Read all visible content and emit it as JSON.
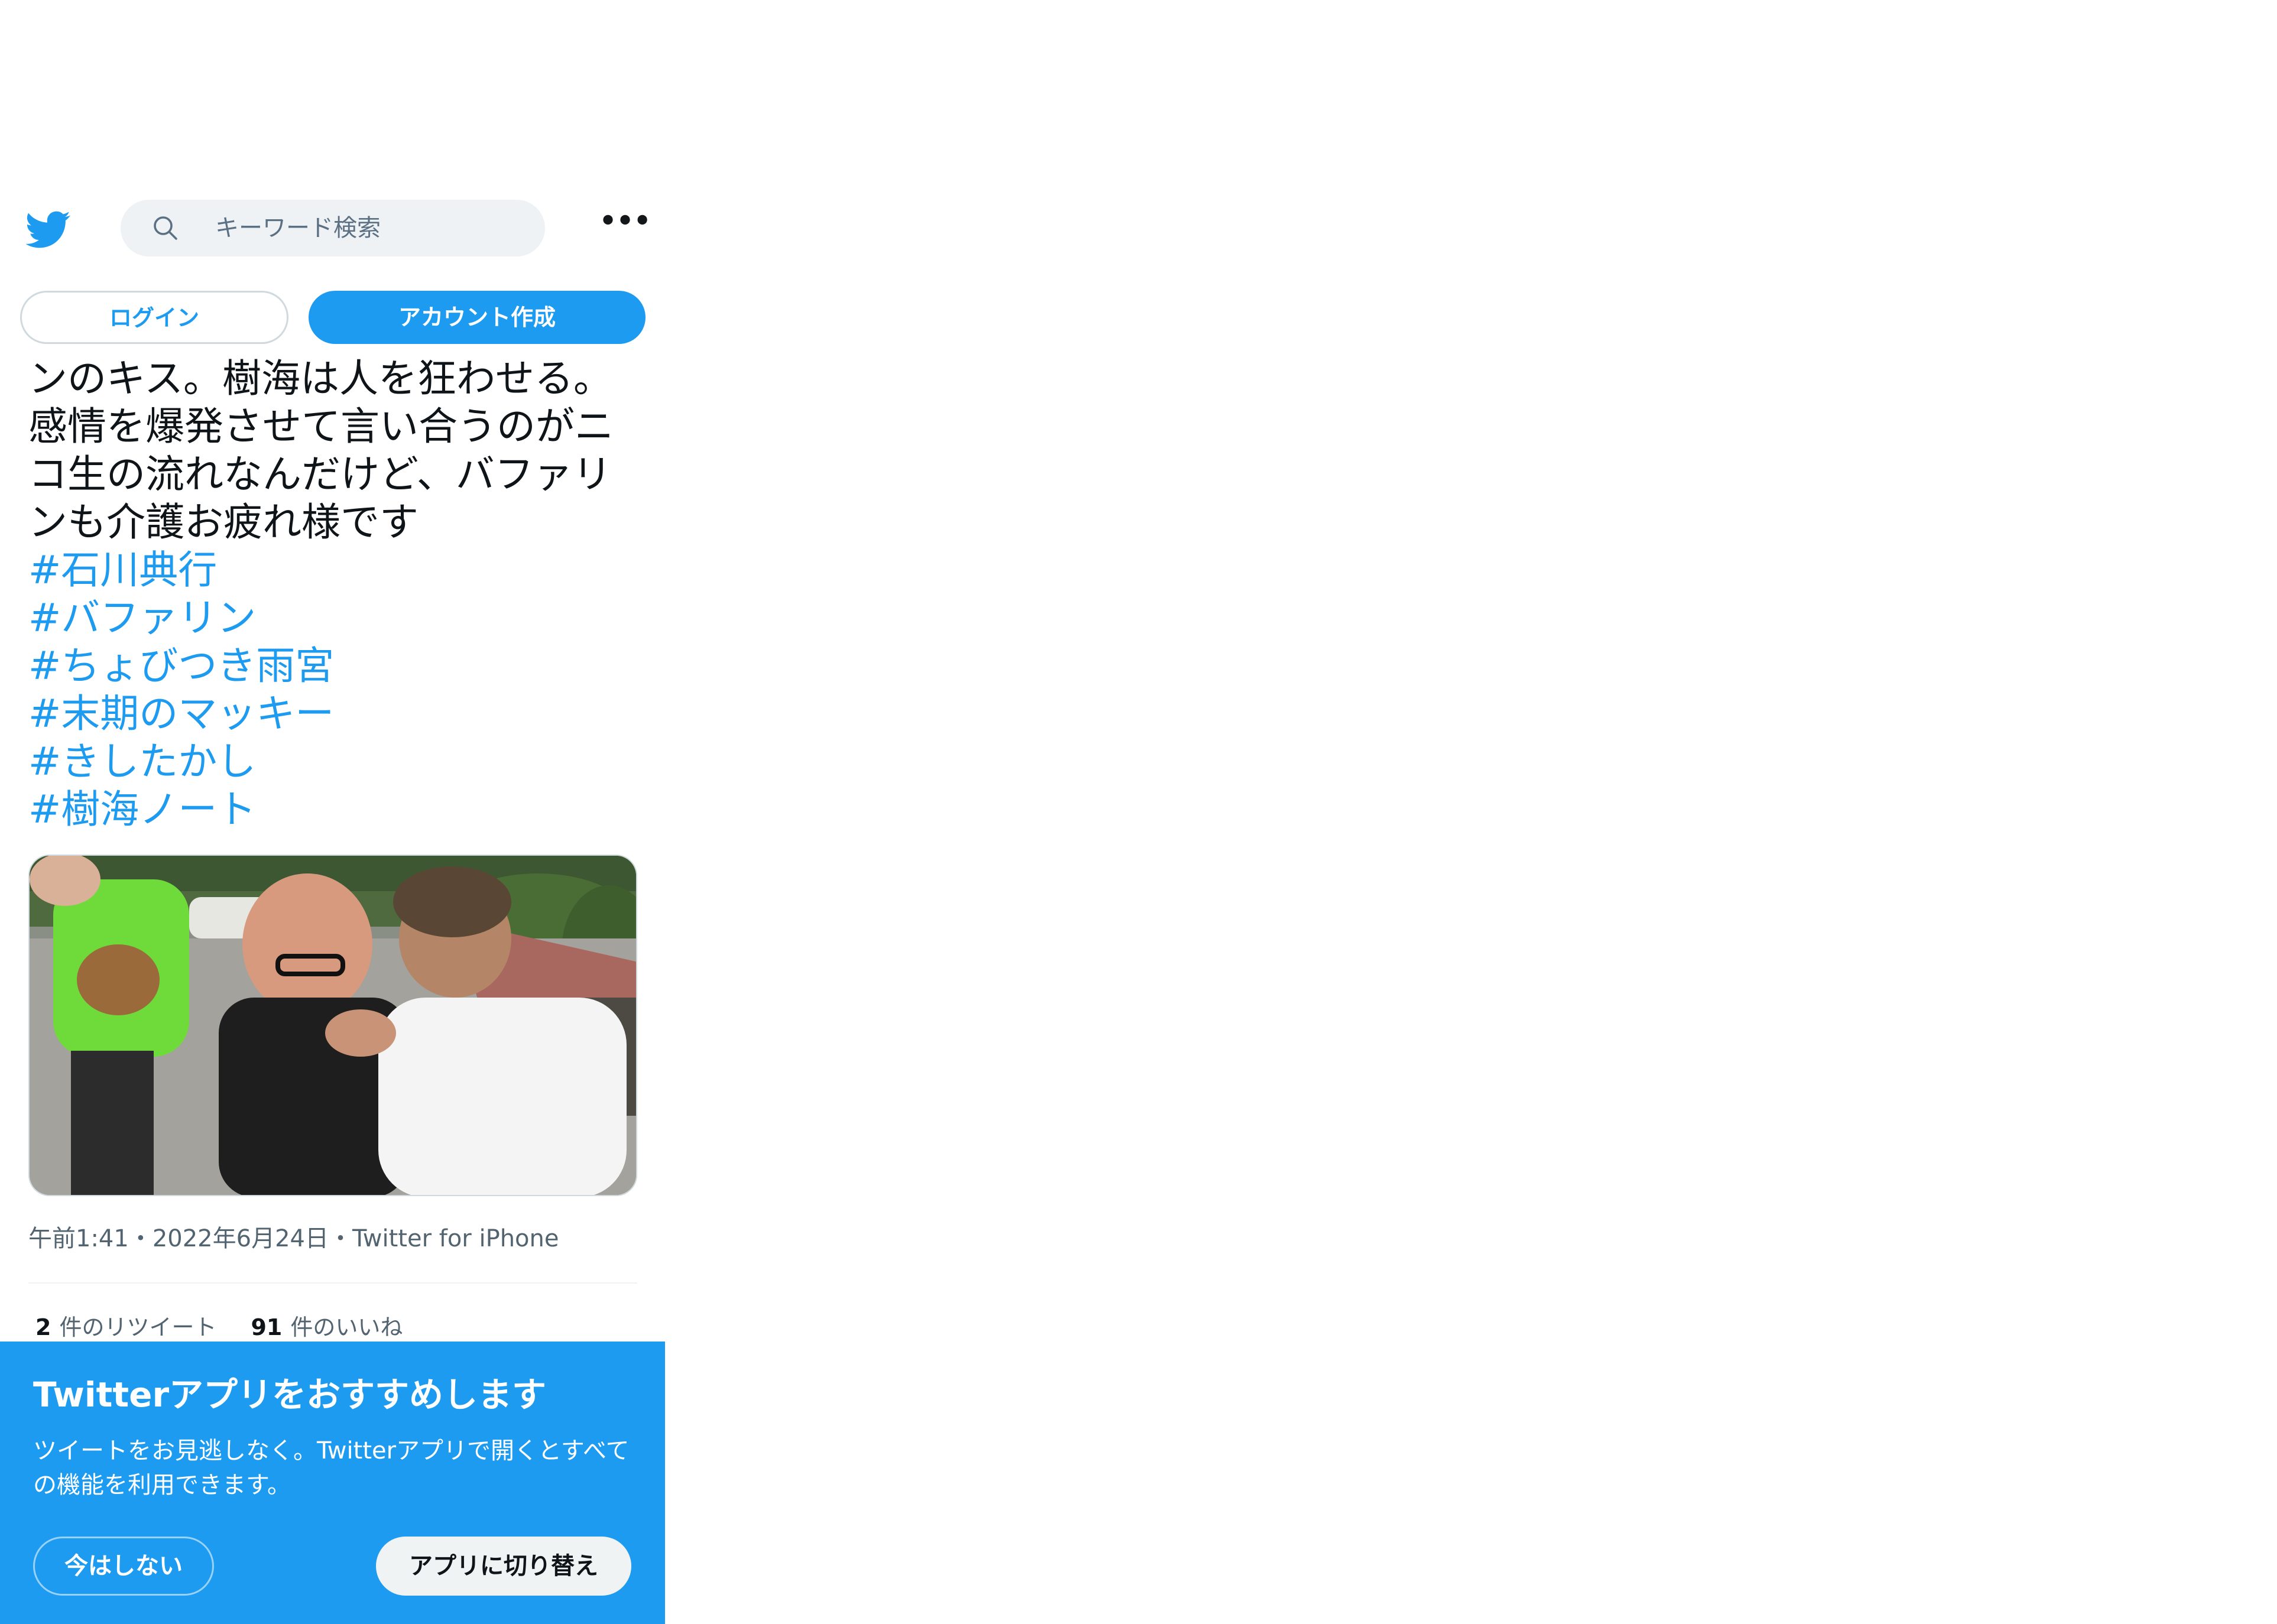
{
  "header": {
    "logo_icon": "twitter-bird-icon",
    "search_placeholder": "キーワード検索",
    "more_icon": "more-dots-icon",
    "more_label": "•••"
  },
  "auth": {
    "login_label": "ログイン",
    "signup_label": "アカウント作成"
  },
  "tweet": {
    "text": "ンのキス。樹海は人を狂わせる。\n感情を爆発させて言い合うのがニ\nコ生の流れなんだけど、バファリ\nンも介護お疲れ様です",
    "hashtags": [
      "#石川典行",
      "#バファリン",
      "#ちょびつき雨宮",
      "#末期のマッキー",
      "#きしたかし",
      "#樹海ノート"
    ],
    "meta": "午前1:41・2022年6月24日・Twitter for iPhone",
    "retweets_count": "2",
    "retweets_label": "件のリツイート",
    "likes_count": "91",
    "likes_label": "件のいいね"
  },
  "banner": {
    "title": "Twitterアプリをおすすめします",
    "description": "ツイートをお見逃しなく。Twitterアプリで開くとすべての機能を利用できます。",
    "not_now_label": "今はしない",
    "switch_label": "アプリに切り替え"
  },
  "colors": {
    "brand_blue": "#1d9bf0",
    "text_primary": "#0f1419",
    "text_secondary": "#536471"
  }
}
